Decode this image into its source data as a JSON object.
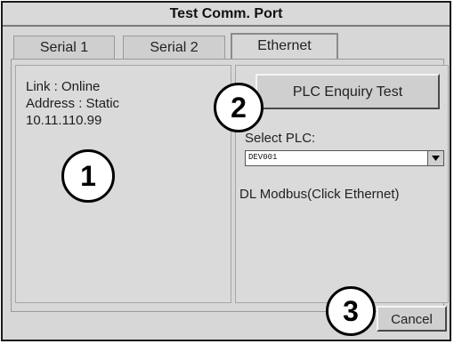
{
  "window": {
    "title": "Test Comm. Port"
  },
  "tabs": [
    {
      "label": "Serial 1",
      "active": false
    },
    {
      "label": "Serial 2",
      "active": false
    },
    {
      "label": "Ethernet",
      "active": true
    }
  ],
  "status": {
    "link": "Link   : Online",
    "address": "Address : Static",
    "ip": "10.11.110.99"
  },
  "plc_enquiry": {
    "label": "PLC Enquiry Test"
  },
  "select_plc": {
    "label": "Select PLC:",
    "value": "DEV001",
    "icon": "dropdown-arrow-icon"
  },
  "protocol": "DL Modbus(Click Ethernet)",
  "cancel": {
    "label": "Cancel"
  },
  "callouts": [
    "1",
    "2",
    "3"
  ],
  "colors": {
    "background": "#d7d7d7",
    "border": "#1a1a1a",
    "callout_fill": "#ffffff",
    "callout_stroke": "#000000"
  }
}
